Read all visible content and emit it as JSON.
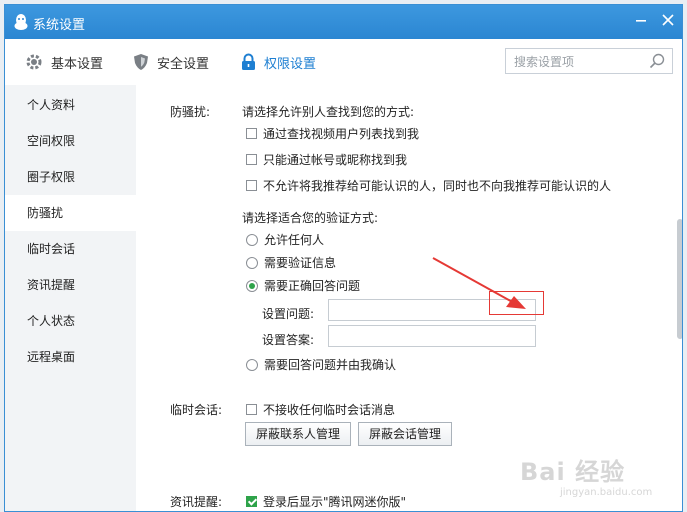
{
  "window": {
    "title": "系统设置"
  },
  "toolbar": {
    "tabs": [
      {
        "label": "基本设置",
        "icon": "gear-icon"
      },
      {
        "label": "安全设置",
        "icon": "shield-icon"
      },
      {
        "label": "权限设置",
        "icon": "lock-icon",
        "active": true
      }
    ],
    "search_placeholder": "搜索设置项"
  },
  "sidebar": {
    "items": [
      {
        "label": "个人资料"
      },
      {
        "label": "空间权限"
      },
      {
        "label": "圈子权限"
      },
      {
        "label": "防骚扰",
        "active": true
      },
      {
        "label": "临时会话"
      },
      {
        "label": "资讯提醒"
      },
      {
        "label": "个人状态"
      },
      {
        "label": "远程桌面"
      }
    ]
  },
  "anti_harass": {
    "section_label": "防骚扰:",
    "find_prompt": "请选择允许别人查找到您的方式:",
    "find_options": [
      {
        "label": "通过查找视频用户列表找到我",
        "checked": false
      },
      {
        "label": "只能通过帐号或昵称找到我",
        "checked": false
      },
      {
        "label": "不允许将我推荐给可能认识的人，同时也不向我推荐可能认识的人",
        "checked": false
      }
    ],
    "verify_prompt": "请选择适合您的验证方式:",
    "verify_options": [
      {
        "label": "允许任何人",
        "checked": false
      },
      {
        "label": "需要验证信息",
        "checked": false
      },
      {
        "label": "需要正确回答问题",
        "checked": true
      },
      {
        "label": "需要回答问题并由我确认",
        "checked": false
      }
    ],
    "question_label": "设置问题:",
    "answer_label": "设置答案:",
    "question_value": "",
    "answer_value": ""
  },
  "temp_chat": {
    "section_label": "临时会话:",
    "option": {
      "label": "不接收任何临时会话消息",
      "checked": false
    },
    "buttons": [
      "屏蔽联系人管理",
      "屏蔽会话管理"
    ]
  },
  "news": {
    "section_label": "资讯提醒:",
    "option": {
      "label": "登录后显示\"腾讯网迷你版\"",
      "checked": true
    }
  },
  "watermark": {
    "line1": "Bai 经验",
    "line2": "jingyan.baidu.com"
  },
  "colors": {
    "titlebar": "#2b86d2",
    "accent": "#1e7fd2",
    "check_green": "#2ea34a",
    "highlight_red": "#e53935"
  }
}
